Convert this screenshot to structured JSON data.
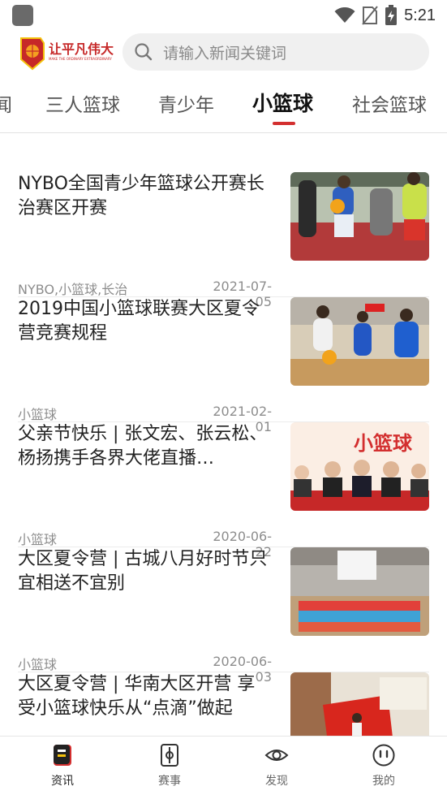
{
  "status_bar": {
    "time": "5:21"
  },
  "header": {
    "logo_text": "让平凡伟大",
    "logo_subtext": "MAKE THE ORDINARY EXTRAORDINARY",
    "search_placeholder": "请输入新闻关键词"
  },
  "tabs": [
    {
      "label": "闻"
    },
    {
      "label": "三人篮球"
    },
    {
      "label": "青少年"
    },
    {
      "label": "小篮球"
    },
    {
      "label": "社会篮球"
    }
  ],
  "news": [
    {
      "title": "NYBO全国青少年篮球公开赛长治赛区开赛",
      "tags": "NYBO,小篮球,长治",
      "date": "2021-07-05"
    },
    {
      "title": "2019中国小篮球联赛大区夏令营竞赛规程",
      "tags": "小篮球",
      "date": "2021-02-01"
    },
    {
      "title": "父亲节快乐 | 张文宏、张云松、杨扬携手各界大佬直播…",
      "tags": "小篮球",
      "date": "2020-06-22",
      "thumb_text": "小篮球"
    },
    {
      "title": "大区夏令营 | 古城八月好时节只宜相送不宜别",
      "tags": "小篮球",
      "date": "2020-06-03"
    },
    {
      "title": "大区夏令营 | 华南大区开营 享受小篮球快乐从“点滴”做起",
      "tags": "",
      "date": ""
    }
  ],
  "bottom_nav": [
    {
      "label": "资讯",
      "icon": "news-icon"
    },
    {
      "label": "赛事",
      "icon": "event-icon"
    },
    {
      "label": "发现",
      "icon": "eye-icon"
    },
    {
      "label": "我的",
      "icon": "profile-icon"
    }
  ],
  "colors": {
    "accent": "#d32f2f",
    "search_bg": "#f0f0f0"
  }
}
